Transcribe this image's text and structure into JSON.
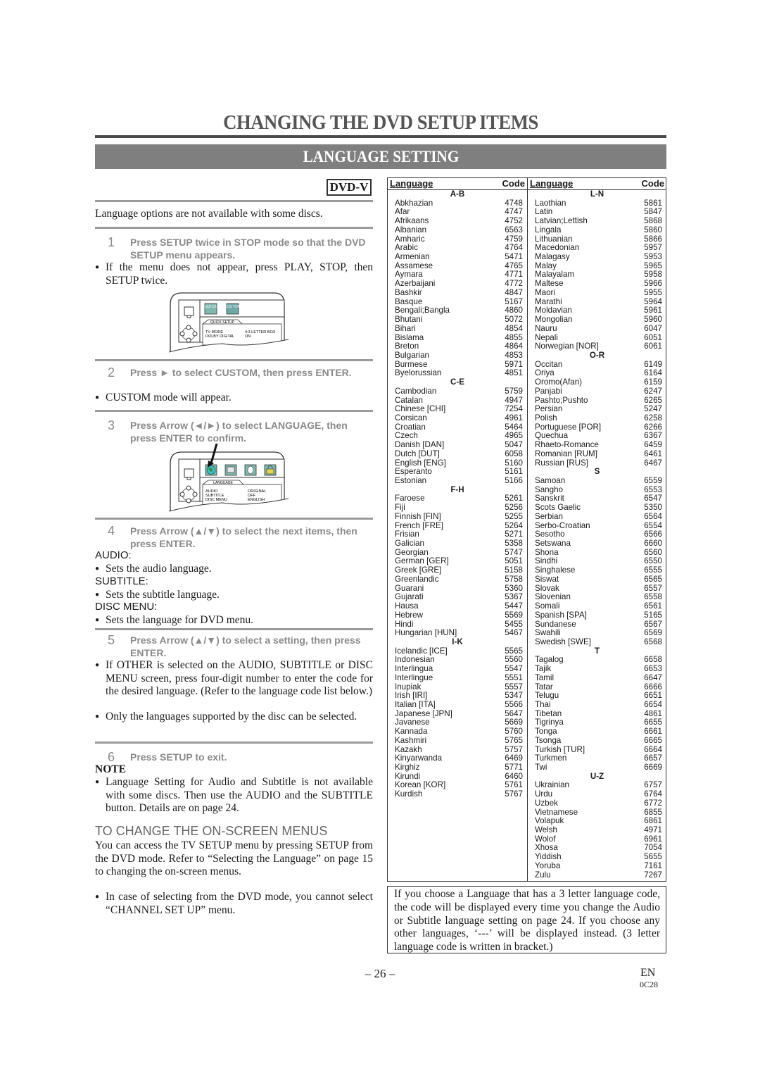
{
  "page": {
    "title": "CHANGING THE DVD SETUP ITEMS",
    "section": "LANGUAGE SETTING",
    "badge": "DVD-V",
    "intro": "Language options are not available with some discs.",
    "page_number": "– 26 –",
    "language_code": "EN",
    "doc_code": "0C28"
  },
  "steps": [
    {
      "num": "1",
      "text": "Press SETUP twice in STOP mode so that the DVD SETUP menu appears."
    },
    {
      "num": "2",
      "text": "Press ► to select CUSTOM, then press ENTER."
    },
    {
      "num": "3",
      "text": "Press Arrow (◄/►) to select LANGUAGE, then press ENTER to confirm."
    },
    {
      "num": "4",
      "text": "Press Arrow (▲/▼) to select the next items, then press ENTER."
    },
    {
      "num": "5",
      "text": "Press Arrow (▲/▼) to select a setting, then press ENTER."
    },
    {
      "num": "6",
      "text": "Press SETUP to exit."
    }
  ],
  "bullets": {
    "step1": "If the menu does not appear, press PLAY, STOP, then SETUP twice.",
    "step2": "CUSTOM mode will appear.",
    "audio": "Sets the audio language.",
    "subtitle": "Sets the subtitle language.",
    "disc_menu": "Sets the language for DVD menu.",
    "step5a": "If OTHER is selected on the AUDIO, SUBTITLE or DISC MENU screen, press four-digit number to enter the code for the desired language. (Refer to the language code list below.)",
    "step5b": "Only the languages supported by the disc can be selected.",
    "note": "Language Setting for Audio and Subtitle is not available with some discs. Then use the AUDIO and the SUBTITLE button. Details are on page 24.",
    "onscreen": "In case of selecting from the DVD mode, you cannot select “CHANNEL SET UP” menu."
  },
  "labels": {
    "audio": "AUDIO:",
    "subtitle": "SUBTITLE:",
    "disc_menu": "DISC MENU:",
    "note": "NOTE",
    "onscreen_heading": "TO CHANGE THE ON-SCREEN MENUS",
    "onscreen_body": "You can access the TV SETUP menu by pressing SETUP from the DVD mode. Refer to “Selecting the Language” on page 15 to changing the on-screen menus."
  },
  "menu1": {
    "icon1": "QUI CK",
    "icon2": "CUS TOM",
    "tab": "QUICK SETUP",
    "rows": [
      {
        "label": "TV MODE",
        "value": "4:3 LETTER BOX"
      },
      {
        "label": "DOLBY DIGITAL",
        "value": "ON"
      }
    ]
  },
  "menu2": {
    "tab": "LANGUAGE",
    "rows": [
      {
        "label": "AUDIO",
        "value": "ORIGINAL"
      },
      {
        "label": "SUBTITLE",
        "value": "OFF"
      },
      {
        "label": "DISC MENU",
        "value": "ENGLISH"
      }
    ]
  },
  "table": {
    "header_language": "Language",
    "header_code": "Code",
    "left": [
      {
        "group": "A-B"
      },
      {
        "lang": "Abkhazian",
        "code": "4748"
      },
      {
        "lang": "Afar",
        "code": "4747"
      },
      {
        "lang": "Afrikaans",
        "code": "4752"
      },
      {
        "lang": "Albanian",
        "code": "6563"
      },
      {
        "lang": "Amharic",
        "code": "4759"
      },
      {
        "lang": "Arabic",
        "code": "4764"
      },
      {
        "lang": "Armenian",
        "code": "5471"
      },
      {
        "lang": "Assamese",
        "code": "4765"
      },
      {
        "lang": "Aymara",
        "code": "4771"
      },
      {
        "lang": "Azerbaijani",
        "code": "4772"
      },
      {
        "lang": "Bashkir",
        "code": "4847"
      },
      {
        "lang": "Basque",
        "code": "5167"
      },
      {
        "lang": "Bengali;Bangla",
        "code": "4860"
      },
      {
        "lang": "Bhutani",
        "code": "5072"
      },
      {
        "lang": "Bihari",
        "code": "4854"
      },
      {
        "lang": "Bislama",
        "code": "4855"
      },
      {
        "lang": "Breton",
        "code": "4864"
      },
      {
        "lang": "Bulgarian",
        "code": "4853"
      },
      {
        "lang": "Burmese",
        "code": "5971"
      },
      {
        "lang": "Byelorussian",
        "code": "4851"
      },
      {
        "group": "C-E"
      },
      {
        "lang": "Cambodian",
        "code": "5759"
      },
      {
        "lang": "Catalan",
        "code": "4947"
      },
      {
        "lang": "Chinese [CHI]",
        "code": "7254"
      },
      {
        "lang": "Corsican",
        "code": "4961"
      },
      {
        "lang": "Croatian",
        "code": "5464"
      },
      {
        "lang": "Czech",
        "code": "4965"
      },
      {
        "lang": "Danish [DAN]",
        "code": "5047"
      },
      {
        "lang": "Dutch [DUT]",
        "code": "6058"
      },
      {
        "lang": "English [ENG]",
        "code": "5160"
      },
      {
        "lang": "Esperanto",
        "code": "5161"
      },
      {
        "lang": "Estonian",
        "code": "5166"
      },
      {
        "group": "F-H"
      },
      {
        "lang": "Faroese",
        "code": "5261"
      },
      {
        "lang": "Fiji",
        "code": "5256"
      },
      {
        "lang": "Finnish [FIN]",
        "code": "5255"
      },
      {
        "lang": "French [FRE]",
        "code": "5264"
      },
      {
        "lang": "Frisian",
        "code": "5271"
      },
      {
        "lang": "Galician",
        "code": "5358"
      },
      {
        "lang": "Georgian",
        "code": "5747"
      },
      {
        "lang": "German [GER]",
        "code": "5051"
      },
      {
        "lang": "Greek [GRE]",
        "code": "5158"
      },
      {
        "lang": "Greenlandic",
        "code": "5758"
      },
      {
        "lang": "Guarani",
        "code": "5360"
      },
      {
        "lang": "Gujarati",
        "code": "5367"
      },
      {
        "lang": "Hausa",
        "code": "5447"
      },
      {
        "lang": "Hebrew",
        "code": "5569"
      },
      {
        "lang": "Hindi",
        "code": "5455"
      },
      {
        "lang": "Hungarian [HUN]",
        "code": "5467"
      },
      {
        "group": "I-K"
      },
      {
        "lang": "Icelandic [ICE]",
        "code": "5565"
      },
      {
        "lang": "Indonesian",
        "code": "5560"
      },
      {
        "lang": "Interlingua",
        "code": "5547"
      },
      {
        "lang": "Interlingue",
        "code": "5551"
      },
      {
        "lang": "Inupiak",
        "code": "5557"
      },
      {
        "lang": "Irish [IRI]",
        "code": "5347"
      },
      {
        "lang": "Italian [ITA]",
        "code": "5566"
      },
      {
        "lang": "Japanese [JPN]",
        "code": "5647"
      },
      {
        "lang": "Javanese",
        "code": "5669"
      },
      {
        "lang": "Kannada",
        "code": "5760"
      },
      {
        "lang": "Kashmiri",
        "code": "5765"
      },
      {
        "lang": "Kazakh",
        "code": "5757"
      },
      {
        "lang": "Kinyarwanda",
        "code": "6469"
      },
      {
        "lang": "Kirghiz",
        "code": "5771"
      },
      {
        "lang": "Kirundi",
        "code": "6460"
      },
      {
        "lang": "Korean [KOR]",
        "code": "5761"
      },
      {
        "lang": "Kurdish",
        "code": "5767"
      }
    ],
    "right": [
      {
        "group": "L-N"
      },
      {
        "lang": "Laothian",
        "code": "5861"
      },
      {
        "lang": "Latin",
        "code": "5847"
      },
      {
        "lang": "Latvian;Lettish",
        "code": "5868"
      },
      {
        "lang": "Lingala",
        "code": "5860"
      },
      {
        "lang": "Lithuanian",
        "code": "5866"
      },
      {
        "lang": "Macedonian",
        "code": "5957"
      },
      {
        "lang": "Malagasy",
        "code": "5953"
      },
      {
        "lang": "Malay",
        "code": "5965"
      },
      {
        "lang": "Malayalam",
        "code": "5958"
      },
      {
        "lang": "Maltese",
        "code": "5966"
      },
      {
        "lang": "Maori",
        "code": "5955"
      },
      {
        "lang": "Marathi",
        "code": "5964"
      },
      {
        "lang": "Moldavian",
        "code": "5961"
      },
      {
        "lang": "Mongolian",
        "code": "5960"
      },
      {
        "lang": "Nauru",
        "code": "6047"
      },
      {
        "lang": "Nepali",
        "code": "6051"
      },
      {
        "lang": "Norwegian [NOR]",
        "code": "6061"
      },
      {
        "group": "O-R"
      },
      {
        "lang": "Occitan",
        "code": "6149"
      },
      {
        "lang": "Oriya",
        "code": "6164"
      },
      {
        "lang": "Oromo(Afan)",
        "code": "6159"
      },
      {
        "lang": "Panjabi",
        "code": "6247"
      },
      {
        "lang": "Pashto;Pushto",
        "code": "6265"
      },
      {
        "lang": "Persian",
        "code": "5247"
      },
      {
        "lang": "Polish",
        "code": "6258"
      },
      {
        "lang": "Portuguese [POR]",
        "code": "6266"
      },
      {
        "lang": "Quechua",
        "code": "6367"
      },
      {
        "lang": "Rhaeto-Romance",
        "code": "6459"
      },
      {
        "lang": "Romanian [RUM]",
        "code": "6461"
      },
      {
        "lang": "Russian [RUS]",
        "code": "6467"
      },
      {
        "group": "S"
      },
      {
        "lang": "Samoan",
        "code": "6559"
      },
      {
        "lang": "Sangho",
        "code": "6553"
      },
      {
        "lang": "Sanskrit",
        "code": "6547"
      },
      {
        "lang": "Scots Gaelic",
        "code": "5350"
      },
      {
        "lang": "Serbian",
        "code": "6564"
      },
      {
        "lang": "Serbo-Croatian",
        "code": "6554"
      },
      {
        "lang": "Sesotho",
        "code": "6566"
      },
      {
        "lang": "Setswana",
        "code": "6660"
      },
      {
        "lang": "Shona",
        "code": "6560"
      },
      {
        "lang": "Sindhi",
        "code": "6550"
      },
      {
        "lang": "Singhalese",
        "code": "6555"
      },
      {
        "lang": "Siswat",
        "code": "6565"
      },
      {
        "lang": "Slovak",
        "code": "6557"
      },
      {
        "lang": "Slovenian",
        "code": "6558"
      },
      {
        "lang": "Somali",
        "code": "6561"
      },
      {
        "lang": "Spanish [SPA]",
        "code": "5165"
      },
      {
        "lang": "Sundanese",
        "code": "6567"
      },
      {
        "lang": "Swahili",
        "code": "6569"
      },
      {
        "lang": "Swedish [SWE]",
        "code": "6568"
      },
      {
        "group": "T"
      },
      {
        "lang": "Tagalog",
        "code": "6658"
      },
      {
        "lang": "Tajik",
        "code": "6653"
      },
      {
        "lang": "Tamil",
        "code": "6647"
      },
      {
        "lang": "Tatar",
        "code": "6666"
      },
      {
        "lang": "Telugu",
        "code": "6651"
      },
      {
        "lang": "Thai",
        "code": "6654"
      },
      {
        "lang": "Tibetan",
        "code": "4861"
      },
      {
        "lang": "Tigrinya",
        "code": "6655"
      },
      {
        "lang": "Tonga",
        "code": "6661"
      },
      {
        "lang": "Tsonga",
        "code": "6665"
      },
      {
        "lang": "Turkish [TUR]",
        "code": "6664"
      },
      {
        "lang": "Turkmen",
        "code": "6657"
      },
      {
        "lang": "Twi",
        "code": "6669"
      },
      {
        "group": "U-Z"
      },
      {
        "lang": "Ukrainian",
        "code": "6757"
      },
      {
        "lang": "Urdu",
        "code": "6764"
      },
      {
        "lang": "Uzbek",
        "code": "6772"
      },
      {
        "lang": "Vietnamese",
        "code": "6855"
      },
      {
        "lang": "Volapuk",
        "code": "6861"
      },
      {
        "lang": "Welsh",
        "code": "4971"
      },
      {
        "lang": "Wolof",
        "code": "6961"
      },
      {
        "lang": "Xhosa",
        "code": "7054"
      },
      {
        "lang": "Yiddish",
        "code": "5655"
      },
      {
        "lang": "Yoruba",
        "code": "7161"
      },
      {
        "lang": "Zulu",
        "code": "7267"
      }
    ]
  },
  "info_box": "If you choose a Language that has a 3 letter language code, the code will be displayed every time you change the Audio or Subtitle language setting on page 24. If you choose any other languages, ‘---’ will be displayed instead. (3 letter language code is written in bracket.)",
  "colors": {
    "section_bar": "#7f7f7f",
    "step_text": "#8a8a8a",
    "icon_teal": "#7fb8b0",
    "icon_cyan": "#34c0c8",
    "icon_yellow": "#e8d44a"
  }
}
